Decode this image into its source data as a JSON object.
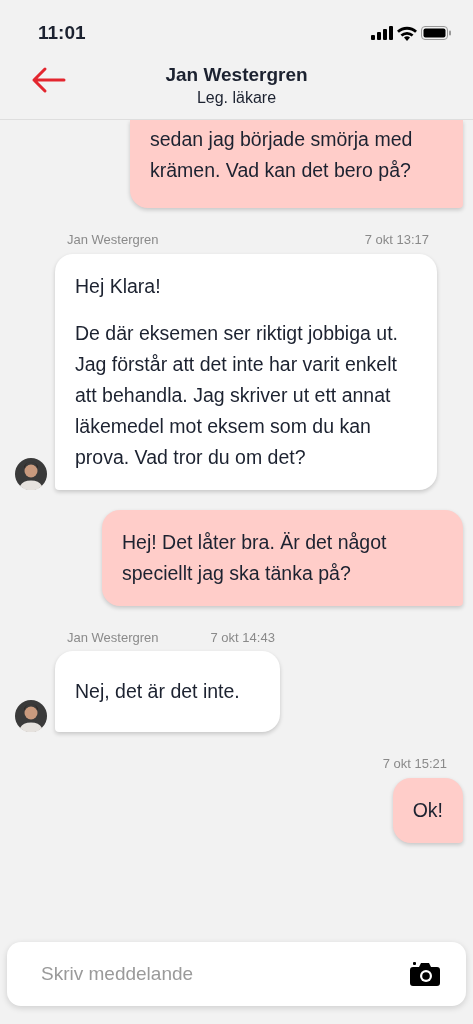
{
  "status_bar": {
    "time": "11:01"
  },
  "header": {
    "title": "Jan Westergren",
    "subtitle": "Leg. läkare"
  },
  "messages": [
    {
      "kind": "outgoing",
      "cut_top": true,
      "paragraphs": [
        "sedan jag började smörja med krämen. Vad kan det bero på?"
      ]
    },
    {
      "kind": "incoming",
      "sender": "Jan Westergren",
      "time": "7 okt 13:17",
      "paragraphs": [
        "Hej Klara!",
        "De där eksemen ser riktigt jobbiga ut. Jag förstår att det inte har varit enkelt att behandla. Jag skriver ut ett annat läkemedel mot eksem som du kan prova. Vad tror du om det?"
      ]
    },
    {
      "kind": "outgoing",
      "paragraphs": [
        "Hej! Det låter bra. Är det något speciellt jag ska tänka på?"
      ]
    },
    {
      "kind": "incoming",
      "sender": "Jan Westergren",
      "time": "7 okt 14:43",
      "paragraphs": [
        "Nej, det är det inte."
      ]
    },
    {
      "kind": "outgoing",
      "time": "7 okt 15:21",
      "paragraphs": [
        "Ok!"
      ]
    }
  ],
  "composer": {
    "placeholder": "Skriv meddelande"
  }
}
